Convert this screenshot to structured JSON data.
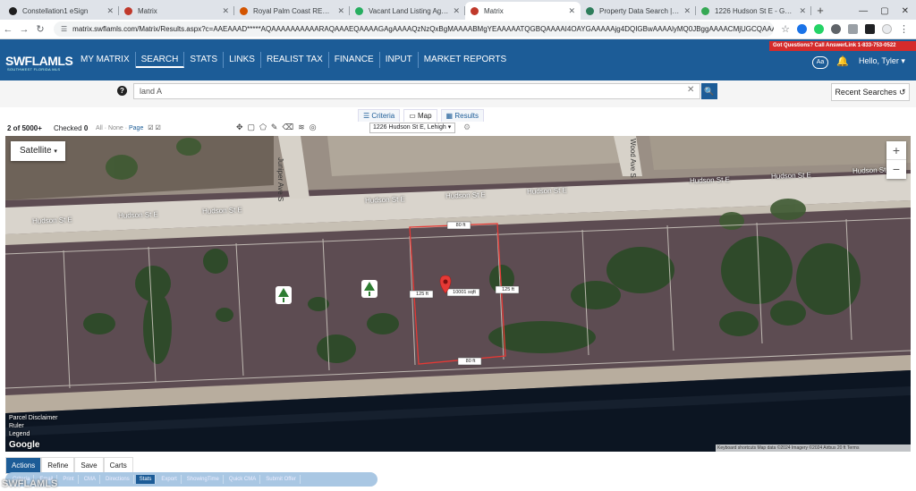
{
  "browser": {
    "tabs": [
      {
        "title": "Constellation1 eSign",
        "color": "#1f1f1f"
      },
      {
        "title": "Matrix",
        "color": "#c0392b"
      },
      {
        "title": "Royal Palm Coast REALTOR® -",
        "color": "#d35400"
      },
      {
        "title": "Vacant Land Listing Agreement",
        "color": "#27ae60"
      },
      {
        "title": "Matrix",
        "color": "#c0392b"
      },
      {
        "title": "Property Data Search | Lee Cou",
        "color": "#2e7d5b"
      },
      {
        "title": "1226 Hudson St E - Google Ma",
        "color": "#34a853"
      }
    ],
    "url": "matrix.swflamls.com/Matrix/Results.aspx?c=AAEAAAD*****AQAAAAAAAAAARAQAAAEQAAAAGAgAAAAQzNzQxBgMAAAABMgYEAAAAATQGBQAAAAI4OAYGAAAAAjg4DQIGBwAAAAlyMQ0JBggAAAACMjUGCQAAAAEwCgYKAAAAATANIAYLA..."
  },
  "header": {
    "logo": "SWFLAMLS",
    "logo_sub": "SOUTHWEST FLORIDA MLS",
    "nav": [
      "MY MATRIX",
      "SEARCH",
      "STATS",
      "LINKS",
      "REALIST TAX",
      "FINANCE",
      "INPUT",
      "MARKET REPORTS"
    ],
    "alert": "Got Questions? Call AnswerLink 1-833-753-0522",
    "aa": "Aa",
    "greeting": "Hello, Tyler"
  },
  "search": {
    "value": "land A",
    "recent": "Recent Searches"
  },
  "view_tabs": [
    "Criteria",
    "Map",
    "Results"
  ],
  "results": {
    "count_prefix": "2",
    "count_suffix": " of 5000+",
    "checked_label": "Checked",
    "checked_value": "0",
    "select_all": "All",
    "select_none": "None",
    "select_page": "Page",
    "address": "1226 Hudson St E, Lehigh"
  },
  "map": {
    "type_button": "Satellite",
    "streets": {
      "hudson": "Hudson St E",
      "juniper": "Juniper Ave S",
      "wood": "Wood Ave S"
    },
    "dims": {
      "top": "80 ft",
      "bottom": "80 ft",
      "left": "125 ft",
      "right": "125 ft",
      "area": "10001 sqft"
    },
    "legend": [
      "Parcel Disclaimer",
      "Ruler",
      "Legend"
    ],
    "google": "Google",
    "attribution": "Keyboard shortcuts   Map data ©2024 Imagery ©2024 Airbus   20 ft   Terms"
  },
  "bottom": {
    "tabs": [
      "Actions",
      "Refine",
      "Save",
      "Carts"
    ],
    "actions": [
      "Criteria",
      "Email",
      "Print",
      "CMA",
      "Directions",
      "Stats",
      "Export",
      "ShowingTime",
      "Quick CMA",
      "Submit Offer"
    ]
  },
  "watermark": "SWFLAMLS"
}
